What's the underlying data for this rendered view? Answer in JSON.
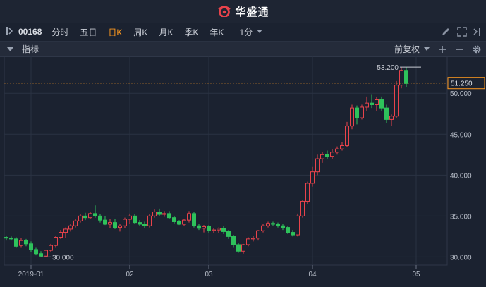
{
  "app": {
    "brand_name": "华盛通"
  },
  "toolbar": {
    "stock_code": "00168",
    "periods": [
      {
        "label": "分时",
        "active": false
      },
      {
        "label": "五日",
        "active": false
      },
      {
        "label": "日K",
        "active": true
      },
      {
        "label": "周K",
        "active": false
      },
      {
        "label": "月K",
        "active": false
      },
      {
        "label": "季K",
        "active": false
      },
      {
        "label": "年K",
        "active": false
      }
    ],
    "interval": "1分"
  },
  "indicator_bar": {
    "label": "指标",
    "adjust_mode": "前复权"
  },
  "colors": {
    "up": "#e8434b",
    "down": "#2ec25b",
    "accent": "#ff9a1f",
    "background": "#1b2230",
    "grid": "#2a3242"
  },
  "chart_data": {
    "type": "candlestick",
    "ylim": [
      29.0,
      54.5
    ],
    "y_ticks": [
      30,
      35,
      40,
      45,
      50
    ],
    "y_tick_labels": [
      "30.000",
      "35.000",
      "40.000",
      "45.000",
      "50.000"
    ],
    "x_ticks": [
      {
        "index": 5,
        "label": "2019-01"
      },
      {
        "index": 25,
        "label": "02"
      },
      {
        "index": 41,
        "label": "03"
      },
      {
        "index": 62,
        "label": "04"
      },
      {
        "index": 83,
        "label": "05"
      }
    ],
    "current_price": 51.25,
    "current_price_label": "51.250",
    "high_annotation": {
      "index": 84,
      "value": 53.2,
      "label": "53.200"
    },
    "low_annotation": {
      "index": 7,
      "value": 30.0,
      "label": "30.000"
    },
    "candles": [
      [
        32.4,
        32.6,
        32.0,
        32.3
      ],
      [
        32.3,
        32.5,
        32.0,
        32.2
      ],
      [
        32.2,
        32.4,
        31.2,
        31.3
      ],
      [
        31.4,
        32.3,
        31.2,
        32.0
      ],
      [
        32.0,
        32.2,
        31.3,
        31.6
      ],
      [
        31.6,
        31.9,
        30.6,
        30.9
      ],
      [
        30.9,
        31.2,
        30.2,
        30.4
      ],
      [
        30.4,
        30.7,
        30.0,
        30.1
      ],
      [
        30.1,
        30.9,
        30.0,
        30.8
      ],
      [
        30.8,
        31.6,
        30.6,
        31.4
      ],
      [
        31.4,
        32.6,
        31.2,
        32.4
      ],
      [
        32.4,
        33.3,
        32.2,
        33.0
      ],
      [
        33.0,
        33.6,
        32.3,
        33.4
      ],
      [
        33.4,
        34.0,
        33.1,
        33.8
      ],
      [
        33.8,
        34.6,
        33.6,
        34.4
      ],
      [
        34.4,
        35.2,
        34.2,
        35.0
      ],
      [
        35.0,
        35.4,
        34.5,
        34.8
      ],
      [
        34.8,
        35.5,
        34.6,
        35.3
      ],
      [
        35.3,
        36.3,
        34.8,
        35.0
      ],
      [
        35.0,
        35.2,
        34.2,
        34.5
      ],
      [
        34.5,
        35.0,
        33.9,
        34.0
      ],
      [
        34.0,
        34.6,
        33.5,
        34.2
      ],
      [
        34.2,
        34.6,
        33.4,
        33.6
      ],
      [
        33.6,
        34.0,
        33.1,
        33.8
      ],
      [
        33.8,
        34.8,
        33.5,
        34.6
      ],
      [
        34.6,
        35.3,
        34.0,
        35.0
      ],
      [
        35.0,
        35.2,
        34.0,
        34.2
      ],
      [
        34.2,
        34.5,
        33.8,
        34.0
      ],
      [
        34.0,
        34.3,
        33.5,
        33.8
      ],
      [
        33.8,
        35.2,
        33.6,
        35.0
      ],
      [
        35.0,
        35.8,
        34.8,
        35.5
      ],
      [
        35.5,
        35.9,
        35.0,
        35.2
      ],
      [
        35.2,
        35.6,
        34.9,
        35.3
      ],
      [
        35.3,
        35.6,
        34.6,
        34.8
      ],
      [
        34.8,
        35.0,
        34.1,
        34.3
      ],
      [
        34.3,
        34.5,
        33.9,
        34.0
      ],
      [
        34.0,
        34.6,
        33.8,
        34.5
      ],
      [
        34.5,
        35.6,
        34.2,
        35.3
      ],
      [
        35.3,
        35.5,
        33.6,
        33.8
      ],
      [
        33.8,
        34.0,
        33.3,
        33.5
      ],
      [
        33.5,
        33.9,
        33.0,
        33.7
      ],
      [
        33.7,
        33.9,
        32.9,
        33.2
      ],
      [
        33.2,
        33.5,
        32.9,
        33.3
      ],
      [
        33.3,
        33.6,
        32.9,
        33.5
      ],
      [
        33.5,
        33.8,
        32.8,
        33.1
      ],
      [
        33.1,
        33.3,
        32.2,
        32.5
      ],
      [
        32.5,
        32.7,
        31.2,
        31.5
      ],
      [
        31.5,
        31.7,
        30.5,
        30.7
      ],
      [
        30.7,
        31.6,
        30.4,
        31.5
      ],
      [
        31.5,
        32.4,
        31.3,
        32.2
      ],
      [
        32.2,
        32.6,
        31.9,
        32.3
      ],
      [
        32.3,
        33.3,
        32.0,
        33.2
      ],
      [
        33.2,
        34.0,
        33.0,
        33.8
      ],
      [
        33.8,
        34.3,
        33.6,
        34.1
      ],
      [
        34.1,
        34.3,
        33.8,
        34.0
      ],
      [
        34.0,
        34.2,
        33.6,
        33.8
      ],
      [
        33.8,
        34.0,
        33.3,
        33.6
      ],
      [
        33.6,
        33.8,
        32.8,
        33.0
      ],
      [
        33.0,
        33.3,
        32.5,
        32.7
      ],
      [
        32.7,
        35.3,
        32.5,
        35.0
      ],
      [
        35.0,
        37.0,
        34.8,
        36.8
      ],
      [
        36.8,
        39.2,
        36.5,
        39.0
      ],
      [
        39.0,
        41.0,
        38.6,
        40.4
      ],
      [
        40.4,
        42.5,
        40.0,
        42.0
      ],
      [
        42.0,
        42.8,
        41.5,
        42.5
      ],
      [
        42.5,
        43.0,
        42.0,
        42.3
      ],
      [
        42.3,
        43.2,
        42.0,
        42.8
      ],
      [
        42.8,
        43.5,
        42.5,
        43.2
      ],
      [
        43.2,
        44.0,
        43.0,
        43.6
      ],
      [
        43.6,
        46.5,
        43.4,
        46.0
      ],
      [
        46.0,
        48.6,
        45.6,
        48.2
      ],
      [
        48.2,
        48.5,
        46.2,
        47.0
      ],
      [
        47.0,
        48.6,
        46.8,
        48.3
      ],
      [
        48.3,
        49.6,
        47.8,
        48.8
      ],
      [
        48.8,
        49.8,
        48.2,
        48.6
      ],
      [
        48.6,
        49.5,
        47.8,
        49.2
      ],
      [
        49.2,
        49.6,
        47.8,
        48.2
      ],
      [
        48.2,
        48.6,
        46.4,
        46.8
      ],
      [
        46.8,
        47.4,
        46.0,
        47.2
      ],
      [
        47.2,
        51.5,
        47.0,
        51.0
      ],
      [
        51.0,
        53.2,
        50.6,
        52.8
      ],
      [
        52.8,
        53.2,
        50.8,
        51.2
      ]
    ]
  }
}
